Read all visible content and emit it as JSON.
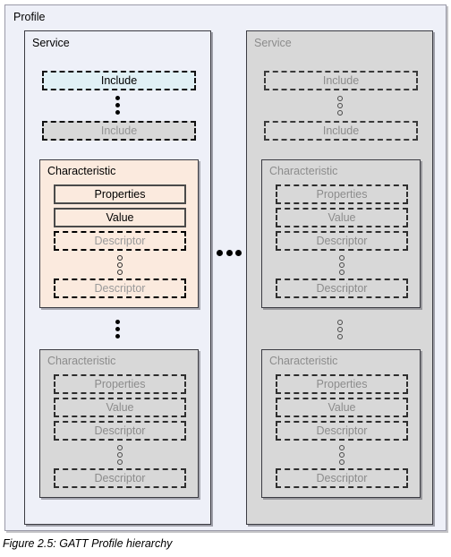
{
  "figure": {
    "caption": "Figure 2.5: GATT Profile hierarchy",
    "profile_label": "Profile",
    "horizontal_ellipsis": "…"
  },
  "colors": {
    "profile_bg": "#eef0f8",
    "service_active_bg": "#eef0f8",
    "service_dim_bg": "#d8d8d8",
    "characteristic_active_bg": "#fbeade",
    "characteristic_dim_bg": "#d8d8d8",
    "include_highlight_bg": "#e0f0f5",
    "dim_text": "#8c8c8c",
    "active_text": "#000000",
    "border_dark": "#3b3b42"
  },
  "services": [
    {
      "id": "service-left",
      "label": "Service",
      "state": "active",
      "includes": [
        {
          "label": "Include",
          "style": "highlight"
        },
        {
          "label": "Include",
          "style": "dimmed"
        }
      ],
      "characteristics": [
        {
          "label": "Characteristic",
          "state": "active",
          "fields": [
            {
              "label": "Properties",
              "style": "solid"
            },
            {
              "label": "Value",
              "style": "solid"
            },
            {
              "label": "Descriptor",
              "style": "dash"
            },
            {
              "label": "Descriptor",
              "style": "dash"
            }
          ]
        },
        {
          "label": "Characteristic",
          "state": "dim",
          "fields": [
            {
              "label": "Properties",
              "style": "dashdim"
            },
            {
              "label": "Value",
              "style": "dashdim"
            },
            {
              "label": "Descriptor",
              "style": "dashdim"
            },
            {
              "label": "Descriptor",
              "style": "dashdim"
            }
          ]
        }
      ]
    },
    {
      "id": "service-right",
      "label": "Service",
      "state": "dim",
      "includes": [
        {
          "label": "Include",
          "style": "ghost"
        },
        {
          "label": "Include",
          "style": "ghost"
        }
      ],
      "characteristics": [
        {
          "label": "Characteristic",
          "state": "dim",
          "fields": [
            {
              "label": "Properties",
              "style": "dashdim"
            },
            {
              "label": "Value",
              "style": "dashdim"
            },
            {
              "label": "Descriptor",
              "style": "dashdim"
            },
            {
              "label": "Descriptor",
              "style": "dashdim"
            }
          ]
        },
        {
          "label": "Characteristic",
          "state": "dim",
          "fields": [
            {
              "label": "Properties",
              "style": "dashdim"
            },
            {
              "label": "Value",
              "style": "dashdim"
            },
            {
              "label": "Descriptor",
              "style": "dashdim"
            },
            {
              "label": "Descriptor",
              "style": "dashdim"
            }
          ]
        }
      ]
    }
  ]
}
